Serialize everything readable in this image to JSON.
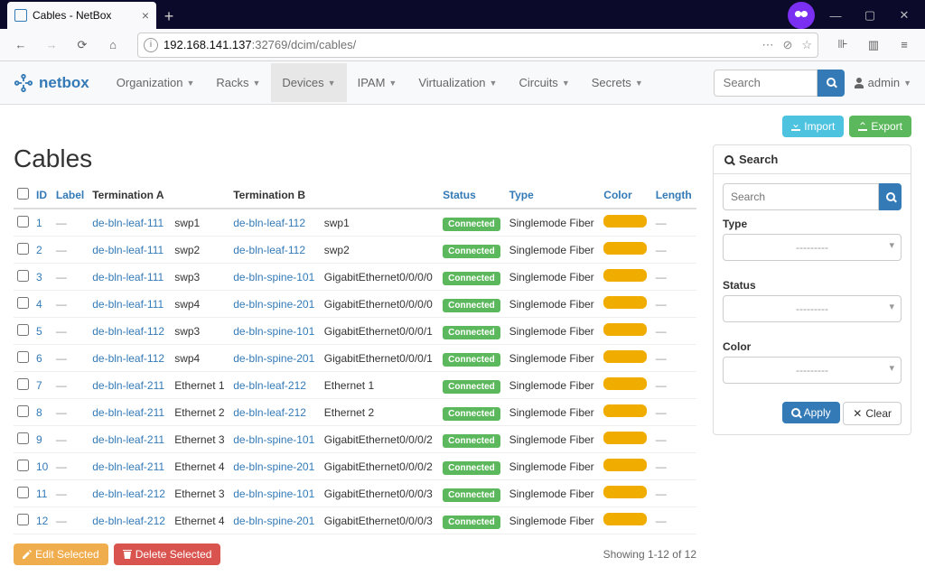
{
  "browser": {
    "tab_title": "Cables - NetBox",
    "url_host": "192.168.141.137",
    "url_path": ":32769/dcim/cables/"
  },
  "nav": {
    "logo": "netbox",
    "items": [
      "Organization",
      "Racks",
      "Devices",
      "IPAM",
      "Virtualization",
      "Circuits",
      "Secrets"
    ],
    "active_index": 2,
    "search_placeholder": "Search",
    "user_label": "admin"
  },
  "actions": {
    "import": "Import",
    "export": "Export",
    "edit_selected": "Edit Selected",
    "delete_selected": "Delete Selected"
  },
  "page_title": "Cables",
  "columns": {
    "id": "ID",
    "label": "Label",
    "term_a": "Termination A",
    "term_b": "Termination B",
    "status": "Status",
    "type": "Type",
    "color": "Color",
    "length": "Length"
  },
  "rows": [
    {
      "id": "1",
      "label": "—",
      "a_dev": "de-bln-leaf-111",
      "a_int": "swp1",
      "b_dev": "de-bln-leaf-112",
      "b_int": "swp1",
      "status": "Connected",
      "type": "Singlemode Fiber",
      "color": "#f0ad00",
      "length": "—"
    },
    {
      "id": "2",
      "label": "—",
      "a_dev": "de-bln-leaf-111",
      "a_int": "swp2",
      "b_dev": "de-bln-leaf-112",
      "b_int": "swp2",
      "status": "Connected",
      "type": "Singlemode Fiber",
      "color": "#f0ad00",
      "length": "—"
    },
    {
      "id": "3",
      "label": "—",
      "a_dev": "de-bln-leaf-111",
      "a_int": "swp3",
      "b_dev": "de-bln-spine-101",
      "b_int": "GigabitEthernet0/0/0/0",
      "status": "Connected",
      "type": "Singlemode Fiber",
      "color": "#f0ad00",
      "length": "—"
    },
    {
      "id": "4",
      "label": "—",
      "a_dev": "de-bln-leaf-111",
      "a_int": "swp4",
      "b_dev": "de-bln-spine-201",
      "b_int": "GigabitEthernet0/0/0/0",
      "status": "Connected",
      "type": "Singlemode Fiber",
      "color": "#f0ad00",
      "length": "—"
    },
    {
      "id": "5",
      "label": "—",
      "a_dev": "de-bln-leaf-112",
      "a_int": "swp3",
      "b_dev": "de-bln-spine-101",
      "b_int": "GigabitEthernet0/0/0/1",
      "status": "Connected",
      "type": "Singlemode Fiber",
      "color": "#f0ad00",
      "length": "—"
    },
    {
      "id": "6",
      "label": "—",
      "a_dev": "de-bln-leaf-112",
      "a_int": "swp4",
      "b_dev": "de-bln-spine-201",
      "b_int": "GigabitEthernet0/0/0/1",
      "status": "Connected",
      "type": "Singlemode Fiber",
      "color": "#f0ad00",
      "length": "—"
    },
    {
      "id": "7",
      "label": "—",
      "a_dev": "de-bln-leaf-211",
      "a_int": "Ethernet 1",
      "b_dev": "de-bln-leaf-212",
      "b_int": "Ethernet 1",
      "status": "Connected",
      "type": "Singlemode Fiber",
      "color": "#f0ad00",
      "length": "—"
    },
    {
      "id": "8",
      "label": "—",
      "a_dev": "de-bln-leaf-211",
      "a_int": "Ethernet 2",
      "b_dev": "de-bln-leaf-212",
      "b_int": "Ethernet 2",
      "status": "Connected",
      "type": "Singlemode Fiber",
      "color": "#f0ad00",
      "length": "—"
    },
    {
      "id": "9",
      "label": "—",
      "a_dev": "de-bln-leaf-211",
      "a_int": "Ethernet 3",
      "b_dev": "de-bln-spine-101",
      "b_int": "GigabitEthernet0/0/0/2",
      "status": "Connected",
      "type": "Singlemode Fiber",
      "color": "#f0ad00",
      "length": "—"
    },
    {
      "id": "10",
      "label": "—",
      "a_dev": "de-bln-leaf-211",
      "a_int": "Ethernet 4",
      "b_dev": "de-bln-spine-201",
      "b_int": "GigabitEthernet0/0/0/2",
      "status": "Connected",
      "type": "Singlemode Fiber",
      "color": "#f0ad00",
      "length": "—"
    },
    {
      "id": "11",
      "label": "—",
      "a_dev": "de-bln-leaf-212",
      "a_int": "Ethernet 3",
      "b_dev": "de-bln-spine-101",
      "b_int": "GigabitEthernet0/0/0/3",
      "status": "Connected",
      "type": "Singlemode Fiber",
      "color": "#f0ad00",
      "length": "—"
    },
    {
      "id": "12",
      "label": "—",
      "a_dev": "de-bln-leaf-212",
      "a_int": "Ethernet 4",
      "b_dev": "de-bln-spine-201",
      "b_int": "GigabitEthernet0/0/0/3",
      "status": "Connected",
      "type": "Singlemode Fiber",
      "color": "#f0ad00",
      "length": "—"
    }
  ],
  "counter": "Showing 1-12 of 12",
  "search_panel": {
    "title": "Search",
    "placeholder": "Search",
    "type_label": "Type",
    "status_label": "Status",
    "color_label": "Color",
    "placeholder_opt": "---------",
    "apply": "Apply",
    "clear": "Clear"
  }
}
